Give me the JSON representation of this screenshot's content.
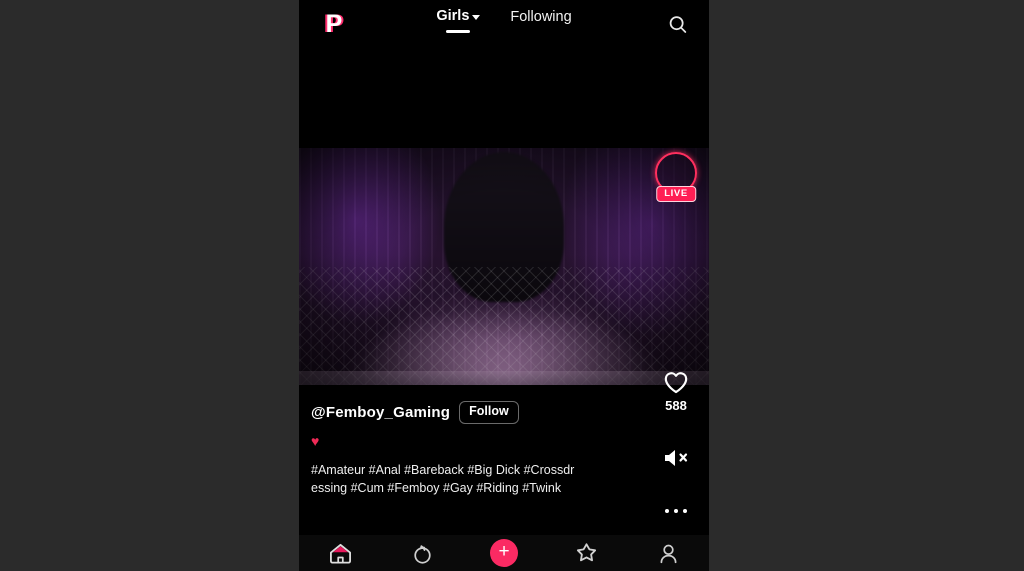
{
  "app": {
    "logo_text": "P",
    "accent_pink": "#fb2a63",
    "live_red": "#ff1f55",
    "background": "#2b2b2b",
    "surface": "#000000"
  },
  "topbar": {
    "tabs": [
      {
        "label": "Girls",
        "active": true,
        "has_caret": true
      },
      {
        "label": "Following",
        "active": false,
        "has_caret": false
      }
    ],
    "search_icon": "search-icon"
  },
  "video": {
    "live_badge_label": "LIVE",
    "is_live": true
  },
  "action_rail": {
    "like_icon": "heart-icon",
    "like_count": "588",
    "sound_icon": "speaker-muted-icon",
    "muted": true,
    "more_icon": "more-dots-icon"
  },
  "meta": {
    "username": "@Femboy_Gaming",
    "follow_label": "Follow",
    "heart_emoji": "♥",
    "tags": "#Amateur #Anal #Bareback #Big Dick #Crossdressing #Cum #Femboy #Gay #Riding #Twink"
  },
  "bottomnav": {
    "items": [
      {
        "name": "home",
        "icon": "home-icon",
        "active": true
      },
      {
        "name": "discover",
        "icon": "fruit-icon",
        "active": false
      },
      {
        "name": "create",
        "icon": "plus-icon",
        "active": false,
        "label": "+"
      },
      {
        "name": "favorites",
        "icon": "star-icon",
        "active": false
      },
      {
        "name": "profile",
        "icon": "person-icon",
        "active": false
      }
    ]
  }
}
